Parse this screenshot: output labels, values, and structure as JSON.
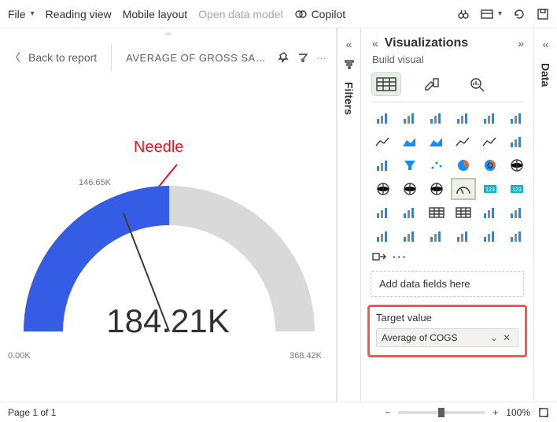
{
  "topbar": {
    "file": "File",
    "reading": "Reading view",
    "mobile": "Mobile layout",
    "data_model": "Open data model",
    "copilot": "Copilot"
  },
  "breadcrumb": {
    "back": "Back to report",
    "title": "AVERAGE OF GROSS SALES AND AVERAG..."
  },
  "annotation": {
    "needle": "Needle"
  },
  "gauge": {
    "value_display": "184.21K",
    "min_label": "0.00K",
    "max_label": "368.42K",
    "needle_label": "146.65K"
  },
  "chart_data": {
    "type": "gauge",
    "title": "Average of Gross Sales and Average of COGS",
    "value": 184.21,
    "min": 0.0,
    "max": 368.42,
    "target": 146.65,
    "unit": "K",
    "fill_color": "#345ce4",
    "track_color": "#d9d9d9"
  },
  "vis": {
    "title": "Visualizations",
    "subtitle": "Build visual",
    "field_well_placeholder": "Add data fields here",
    "target_label": "Target value",
    "target_field": "Average of COGS",
    "more": "···"
  },
  "rails": {
    "filters": "Filters",
    "data": "Data"
  },
  "status": {
    "page": "Page 1 of 1",
    "zoom": "100%"
  },
  "viz_icons": [
    "stacked-bar",
    "clustered-bar",
    "stacked-column",
    "clustered-column",
    "100-bar",
    "100-column",
    "line",
    "area",
    "stacked-area",
    "line-stacked-column",
    "line-clustered-column",
    "ribbon",
    "waterfall",
    "funnel",
    "scatter",
    "pie",
    "donut",
    "treemap",
    "map",
    "filled-map",
    "azure-map",
    "gauge",
    "card",
    "multi-row-card",
    "kpi",
    "slicer",
    "table",
    "matrix",
    "r-visual",
    "python-visual",
    "key-influencers",
    "decomposition-tree",
    "qna",
    "narrative",
    "paginated",
    "power-apps"
  ]
}
